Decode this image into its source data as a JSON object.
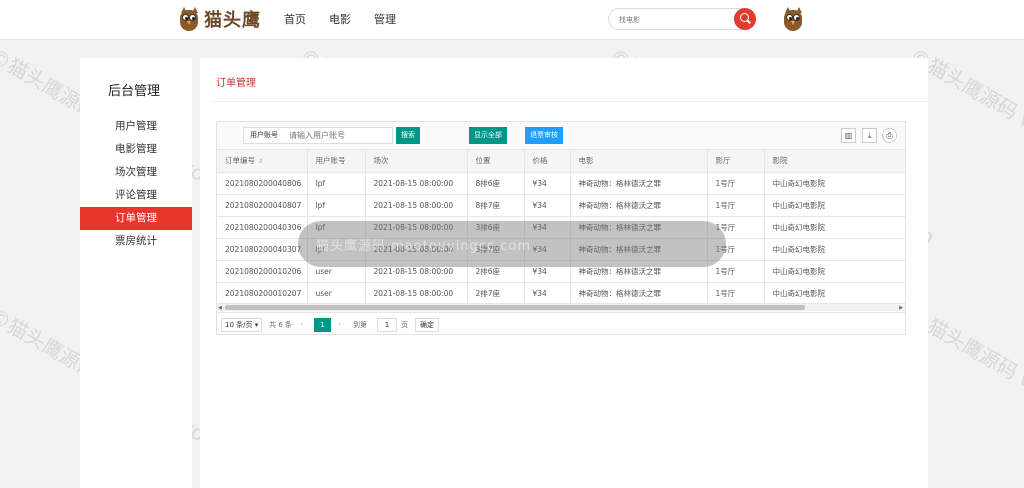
{
  "header": {
    "logo_text": "猫头鹰",
    "nav": [
      "首页",
      "电影",
      "管理"
    ],
    "search_placeholder": "找电影"
  },
  "sidebar": {
    "title": "后台管理",
    "items": [
      {
        "label": "用户管理",
        "active": false
      },
      {
        "label": "电影管理",
        "active": false
      },
      {
        "label": "场次管理",
        "active": false
      },
      {
        "label": "评论管理",
        "active": false
      },
      {
        "label": "订单管理",
        "active": true
      },
      {
        "label": "票房统计",
        "active": false
      }
    ]
  },
  "main": {
    "title": "订单管理",
    "toolbar": {
      "field_label": "用户账号",
      "field_placeholder": "请输入用户账号",
      "search_btn": "搜索",
      "show_all_btn": "显示全部",
      "audit_btn": "退票审核",
      "icons": [
        "columns-icon",
        "export-icon",
        "print-icon"
      ]
    },
    "table": {
      "columns": [
        "订单编号",
        "用户账号",
        "场次",
        "位置",
        "价格",
        "电影",
        "影厅",
        "影院"
      ],
      "rows": [
        [
          "2021080200040806",
          "lpf",
          "2021-08-15 08:00:00",
          "8排6座",
          "¥34",
          "神奇动物：格林德沃之罪",
          "1号厅",
          "中山奇幻电影院"
        ],
        [
          "2021080200040807",
          "lpf",
          "2021-08-15 08:00:00",
          "8排7座",
          "¥34",
          "神奇动物：格林德沃之罪",
          "1号厅",
          "中山奇幻电影院"
        ],
        [
          "2021080200040306",
          "lpf",
          "2021-08-15 08:00:00",
          "3排6座",
          "¥34",
          "神奇动物：格林德沃之罪",
          "1号厅",
          "中山奇幻电影院"
        ],
        [
          "2021080200040307",
          "lpf",
          "2021-08-15 08:00:00",
          "3排7座",
          "¥34",
          "神奇动物：格林德沃之罪",
          "1号厅",
          "中山奇幻电影院"
        ],
        [
          "2021080200010206",
          "user",
          "2021-08-15 08:00:00",
          "2排6座",
          "¥34",
          "神奇动物：格林德沃之罪",
          "1号厅",
          "中山奇幻电影院"
        ],
        [
          "2021080200010207",
          "user",
          "2021-08-15 08:00:00",
          "2排7座",
          "¥34",
          "神奇动物：格林德沃之罪",
          "1号厅",
          "中山奇幻电影院"
        ]
      ]
    },
    "pager": {
      "page_size": "10 条/页",
      "total": "共 6 条",
      "current": "1",
      "goto_label": "到第",
      "goto_value": "1",
      "page_unit": "页",
      "confirm": "确定"
    }
  },
  "toast": "猫头鹰源码 maotouyingcc.com",
  "watermark": "©猫头鹰源码 www.maotouyingcc.com",
  "colors": {
    "accent": "#e8362d",
    "teal": "#009688",
    "blue": "#1e9fff"
  }
}
